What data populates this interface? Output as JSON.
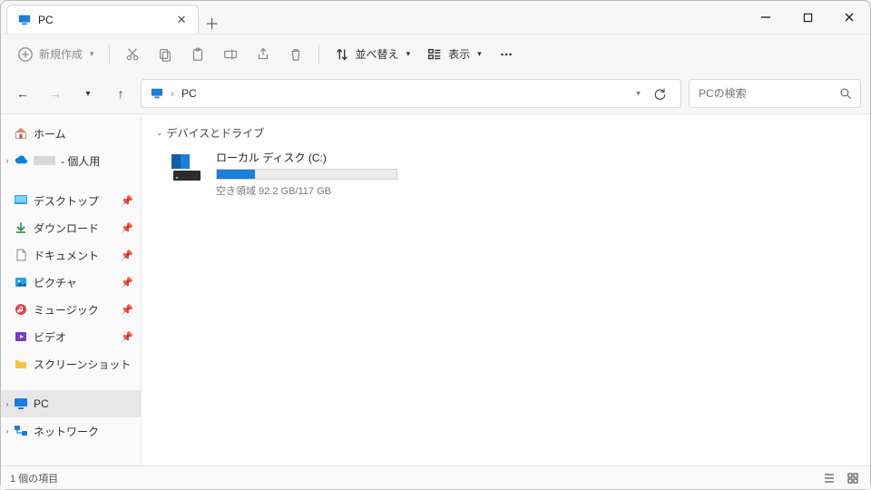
{
  "window": {
    "title": "PC"
  },
  "toolbar": {
    "new_label": "新規作成",
    "sort_label": "並べ替え",
    "view_label": "表示"
  },
  "address": {
    "root": "PC"
  },
  "search": {
    "placeholder": "PCの検索"
  },
  "sidebar": {
    "home": "ホーム",
    "personal_suffix": " - 個人用",
    "desktop": "デスクトップ",
    "downloads": "ダウンロード",
    "documents": "ドキュメント",
    "pictures": "ピクチャ",
    "music": "ミュージック",
    "videos": "ビデオ",
    "screenshots": "スクリーンショット",
    "pc": "PC",
    "network": "ネットワーク"
  },
  "content": {
    "group_devices": "デバイスとドライブ",
    "drive_c": {
      "name": "ローカル ディスク (C:)",
      "free_text": "空き領域 92.2 GB/117 GB",
      "used_fraction": 0.21
    }
  },
  "status": {
    "item_count": "1 個の項目"
  }
}
